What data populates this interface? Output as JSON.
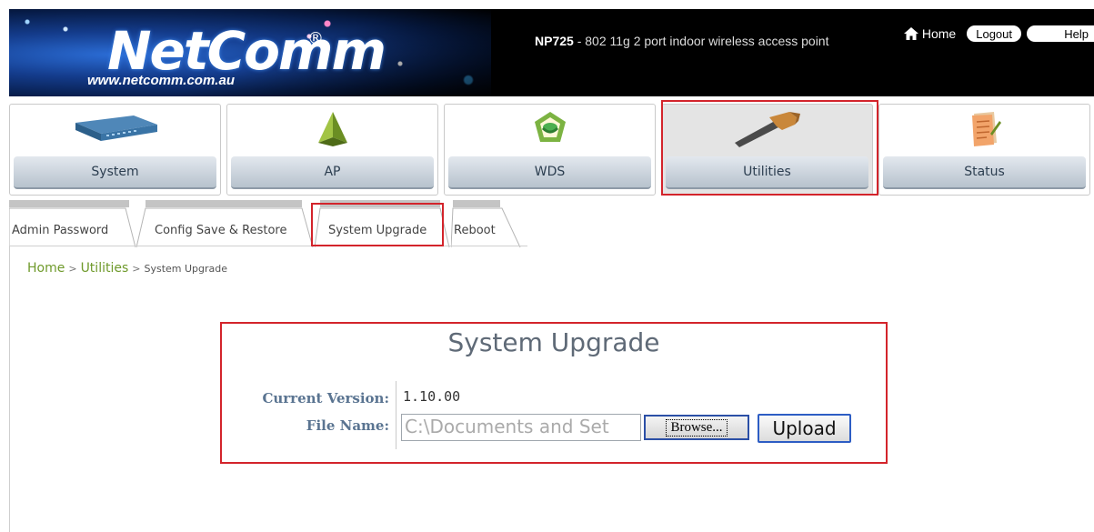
{
  "header": {
    "brand": "NetComm",
    "brand_reg": "®",
    "brand_url": "www.netcomm.com.au",
    "model": "NP725",
    "description": "- 802 11g 2 port indoor wireless access point",
    "links": {
      "home": "Home",
      "logout": "Logout",
      "help": "Help"
    }
  },
  "nav": {
    "items": [
      {
        "label": "System",
        "icon": "router-icon"
      },
      {
        "label": "AP",
        "icon": "access-point-icon"
      },
      {
        "label": "WDS",
        "icon": "wds-icon"
      },
      {
        "label": "Utilities",
        "icon": "hammer-icon"
      },
      {
        "label": "Status",
        "icon": "notepad-icon"
      }
    ],
    "active": "Utilities"
  },
  "subtabs": {
    "items": [
      {
        "label": "Admin Password"
      },
      {
        "label": "Config Save & Restore"
      },
      {
        "label": "System Upgrade"
      },
      {
        "label": "Reboot"
      }
    ],
    "active": "System Upgrade"
  },
  "breadcrumb": {
    "home": "Home",
    "sep": ">",
    "section": "Utilities",
    "current": "System Upgrade"
  },
  "panel": {
    "title": "System Upgrade",
    "current_version_label": "Current Version:",
    "current_version_value": "1.10.00",
    "file_name_label": "File Name:",
    "file_name_value": "C:\\Documents and Set",
    "browse_label": "Browse...",
    "upload_label": "Upload"
  },
  "colors": {
    "highlight": "#d3242b",
    "breadcrumb_link": "#6f9a2b",
    "label": "#5a7491"
  }
}
